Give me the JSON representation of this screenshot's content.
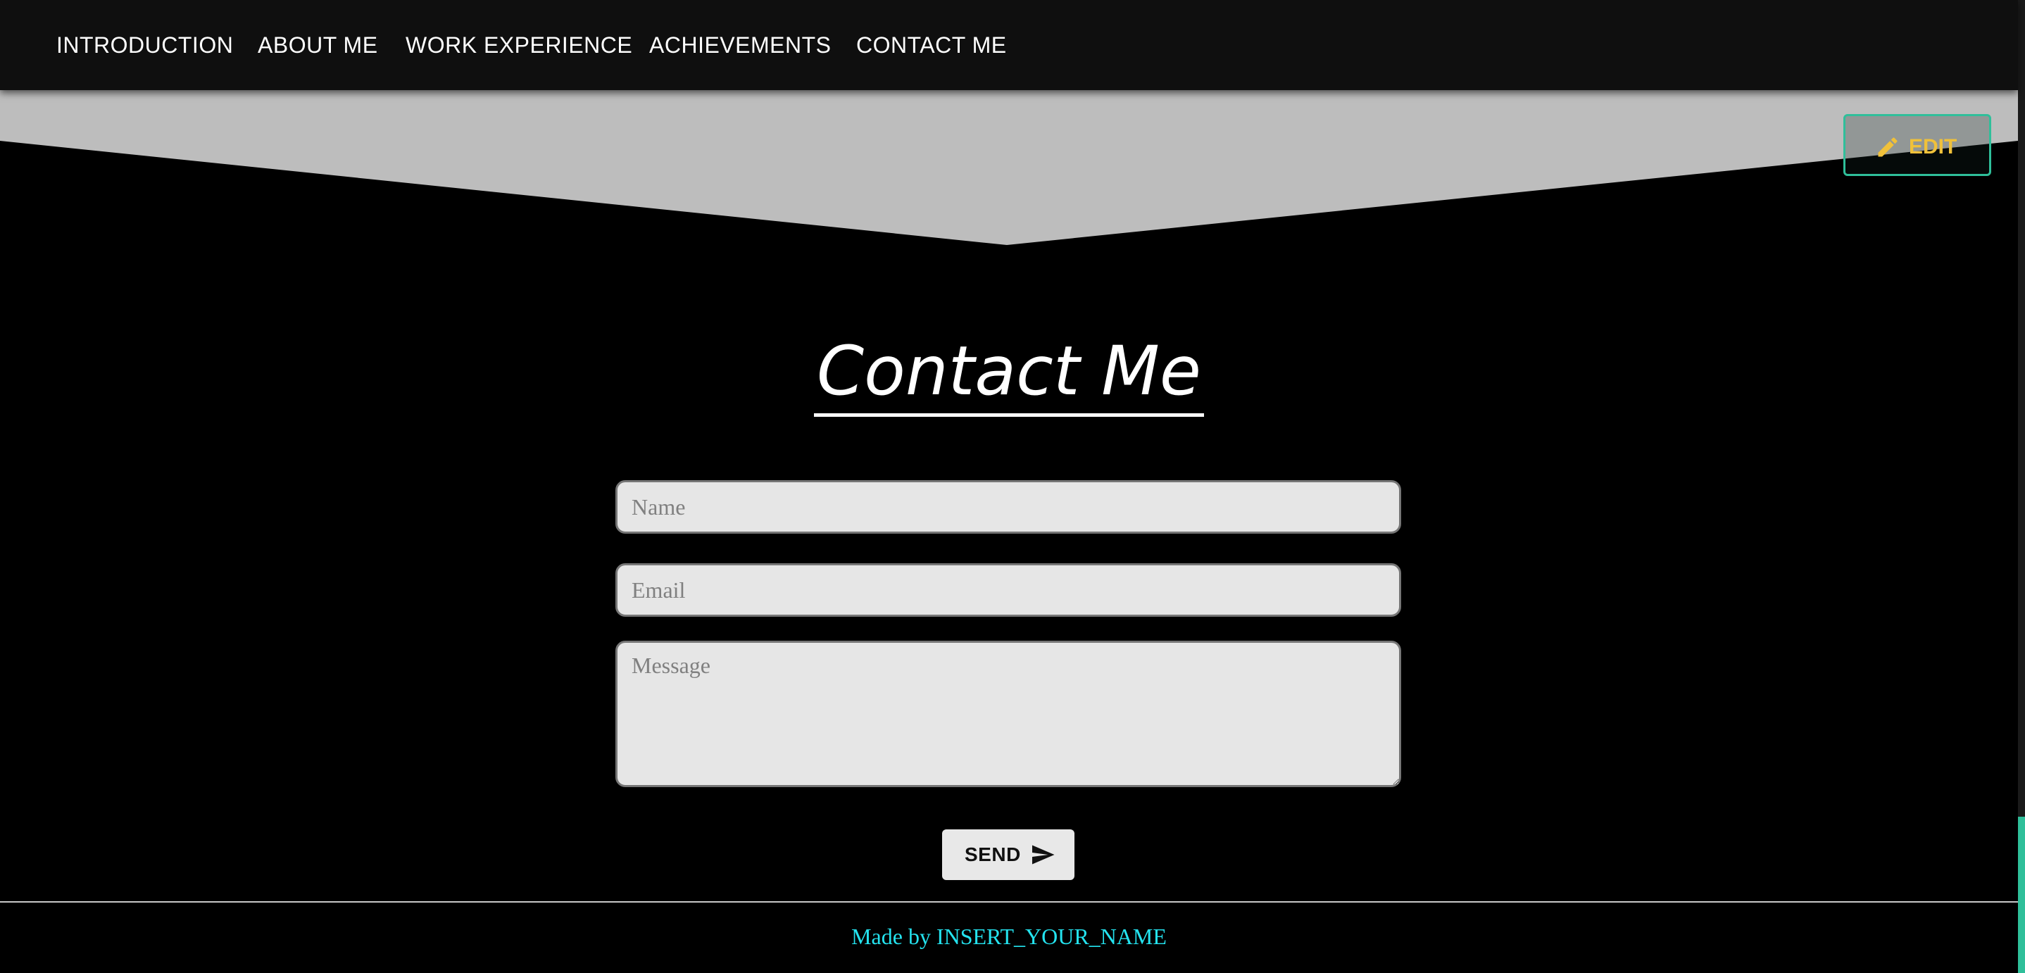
{
  "nav": {
    "items": [
      {
        "label": "INTRODUCTION"
      },
      {
        "label": "ABOUT ME"
      },
      {
        "label": "WORK EXPERIENCE"
      },
      {
        "label": "ACHIEVEMENTS"
      },
      {
        "label": "CONTACT ME"
      }
    ]
  },
  "edit": {
    "label": "EDIT",
    "icon": "pencil-icon"
  },
  "contact": {
    "title": "Contact Me",
    "name_placeholder": "Name",
    "email_placeholder": "Email",
    "message_placeholder": "Message",
    "send_label": "SEND",
    "send_icon": "send-icon"
  },
  "footer": {
    "text": "Made by INSERT_YOUR_NAME"
  },
  "colors": {
    "background": "#000000",
    "navbar": "#0f0f0f",
    "band": "#bdbdbd",
    "accent": "#2fbf9a",
    "edit_text": "#f0c13a",
    "footer_text": "#24e3ef",
    "input_bg": "#e6e6e6"
  }
}
